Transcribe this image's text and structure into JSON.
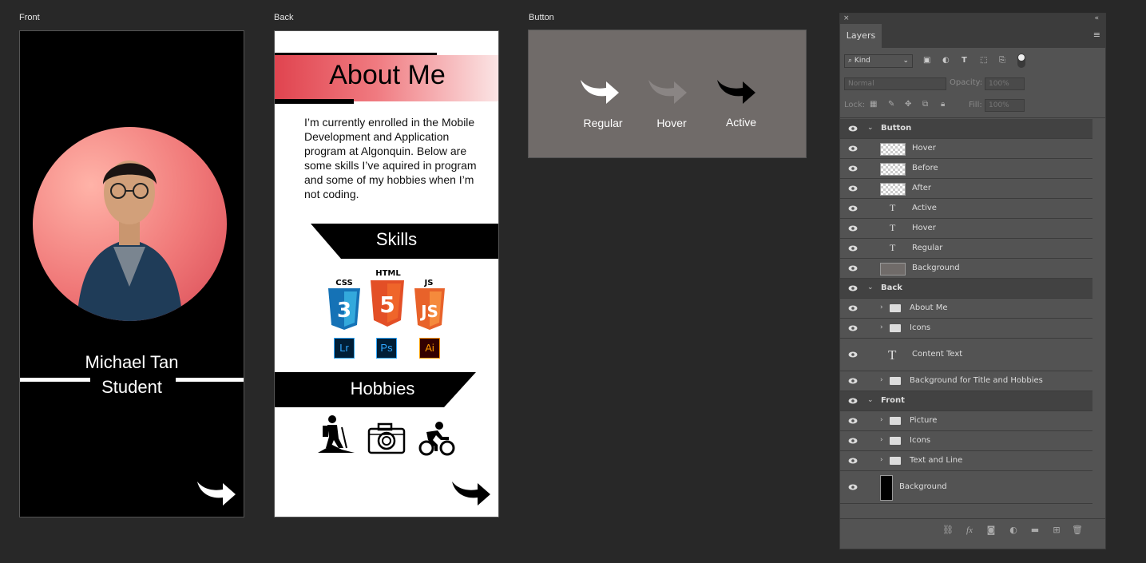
{
  "artboards": {
    "front_label": "Front",
    "back_label": "Back",
    "button_label": "Button"
  },
  "front": {
    "name": "Michael Tan",
    "role": "Student"
  },
  "back": {
    "title": "About Me",
    "content": "I’m currently enrolled in the Mobile Development and Application program at Algonquin. Below are some skills I’ve aquired in program and some of my hobbies when I’m not coding.",
    "skills_title": "Skills",
    "hobbies_title": "Hobbies",
    "skill_icons": [
      {
        "label": "CSS",
        "number": "3",
        "color": "#1572b6"
      },
      {
        "label": "HTML",
        "number": "5",
        "color": "#e34f26"
      },
      {
        "label": "JS",
        "number": "JS",
        "color": "#f07a22"
      }
    ],
    "app_badges": [
      {
        "text": "Lr",
        "color": "#31a8ff"
      },
      {
        "text": "Ps",
        "color": "#31a8ff"
      },
      {
        "text": "Ai",
        "color": "#ff9a00"
      }
    ]
  },
  "button_board": {
    "regular": "Regular",
    "hover": "Hover",
    "active": "Active"
  },
  "layers_panel": {
    "tab": "Layers",
    "filter_kind": "Kind",
    "blend_mode": "Normal",
    "opacity_label": "Opacity:",
    "opacity_value": "100%",
    "lock_label": "Lock:",
    "fill_label": "Fill:",
    "fill_value": "100%",
    "groups": [
      {
        "name": "Button",
        "layers": [
          {
            "type": "raster",
            "name": "Hover"
          },
          {
            "type": "raster",
            "name": "Before"
          },
          {
            "type": "raster",
            "name": "After"
          },
          {
            "type": "text",
            "name": "Active"
          },
          {
            "type": "text",
            "name": "Hover"
          },
          {
            "type": "text",
            "name": "Regular"
          },
          {
            "type": "raster-gray",
            "name": "Background"
          }
        ]
      },
      {
        "name": "Back",
        "layers": [
          {
            "type": "folder",
            "name": "About Me"
          },
          {
            "type": "folder",
            "name": "Icons"
          },
          {
            "type": "text",
            "name": "Content Text"
          },
          {
            "type": "folder",
            "name": "Background for Title and Hobbies"
          }
        ]
      },
      {
        "name": "Front",
        "layers": [
          {
            "type": "folder",
            "name": "Picture"
          },
          {
            "type": "folder",
            "name": "Icons"
          },
          {
            "type": "folder",
            "name": "Text and Line"
          },
          {
            "type": "raster-black",
            "name": "Background"
          }
        ]
      }
    ]
  }
}
